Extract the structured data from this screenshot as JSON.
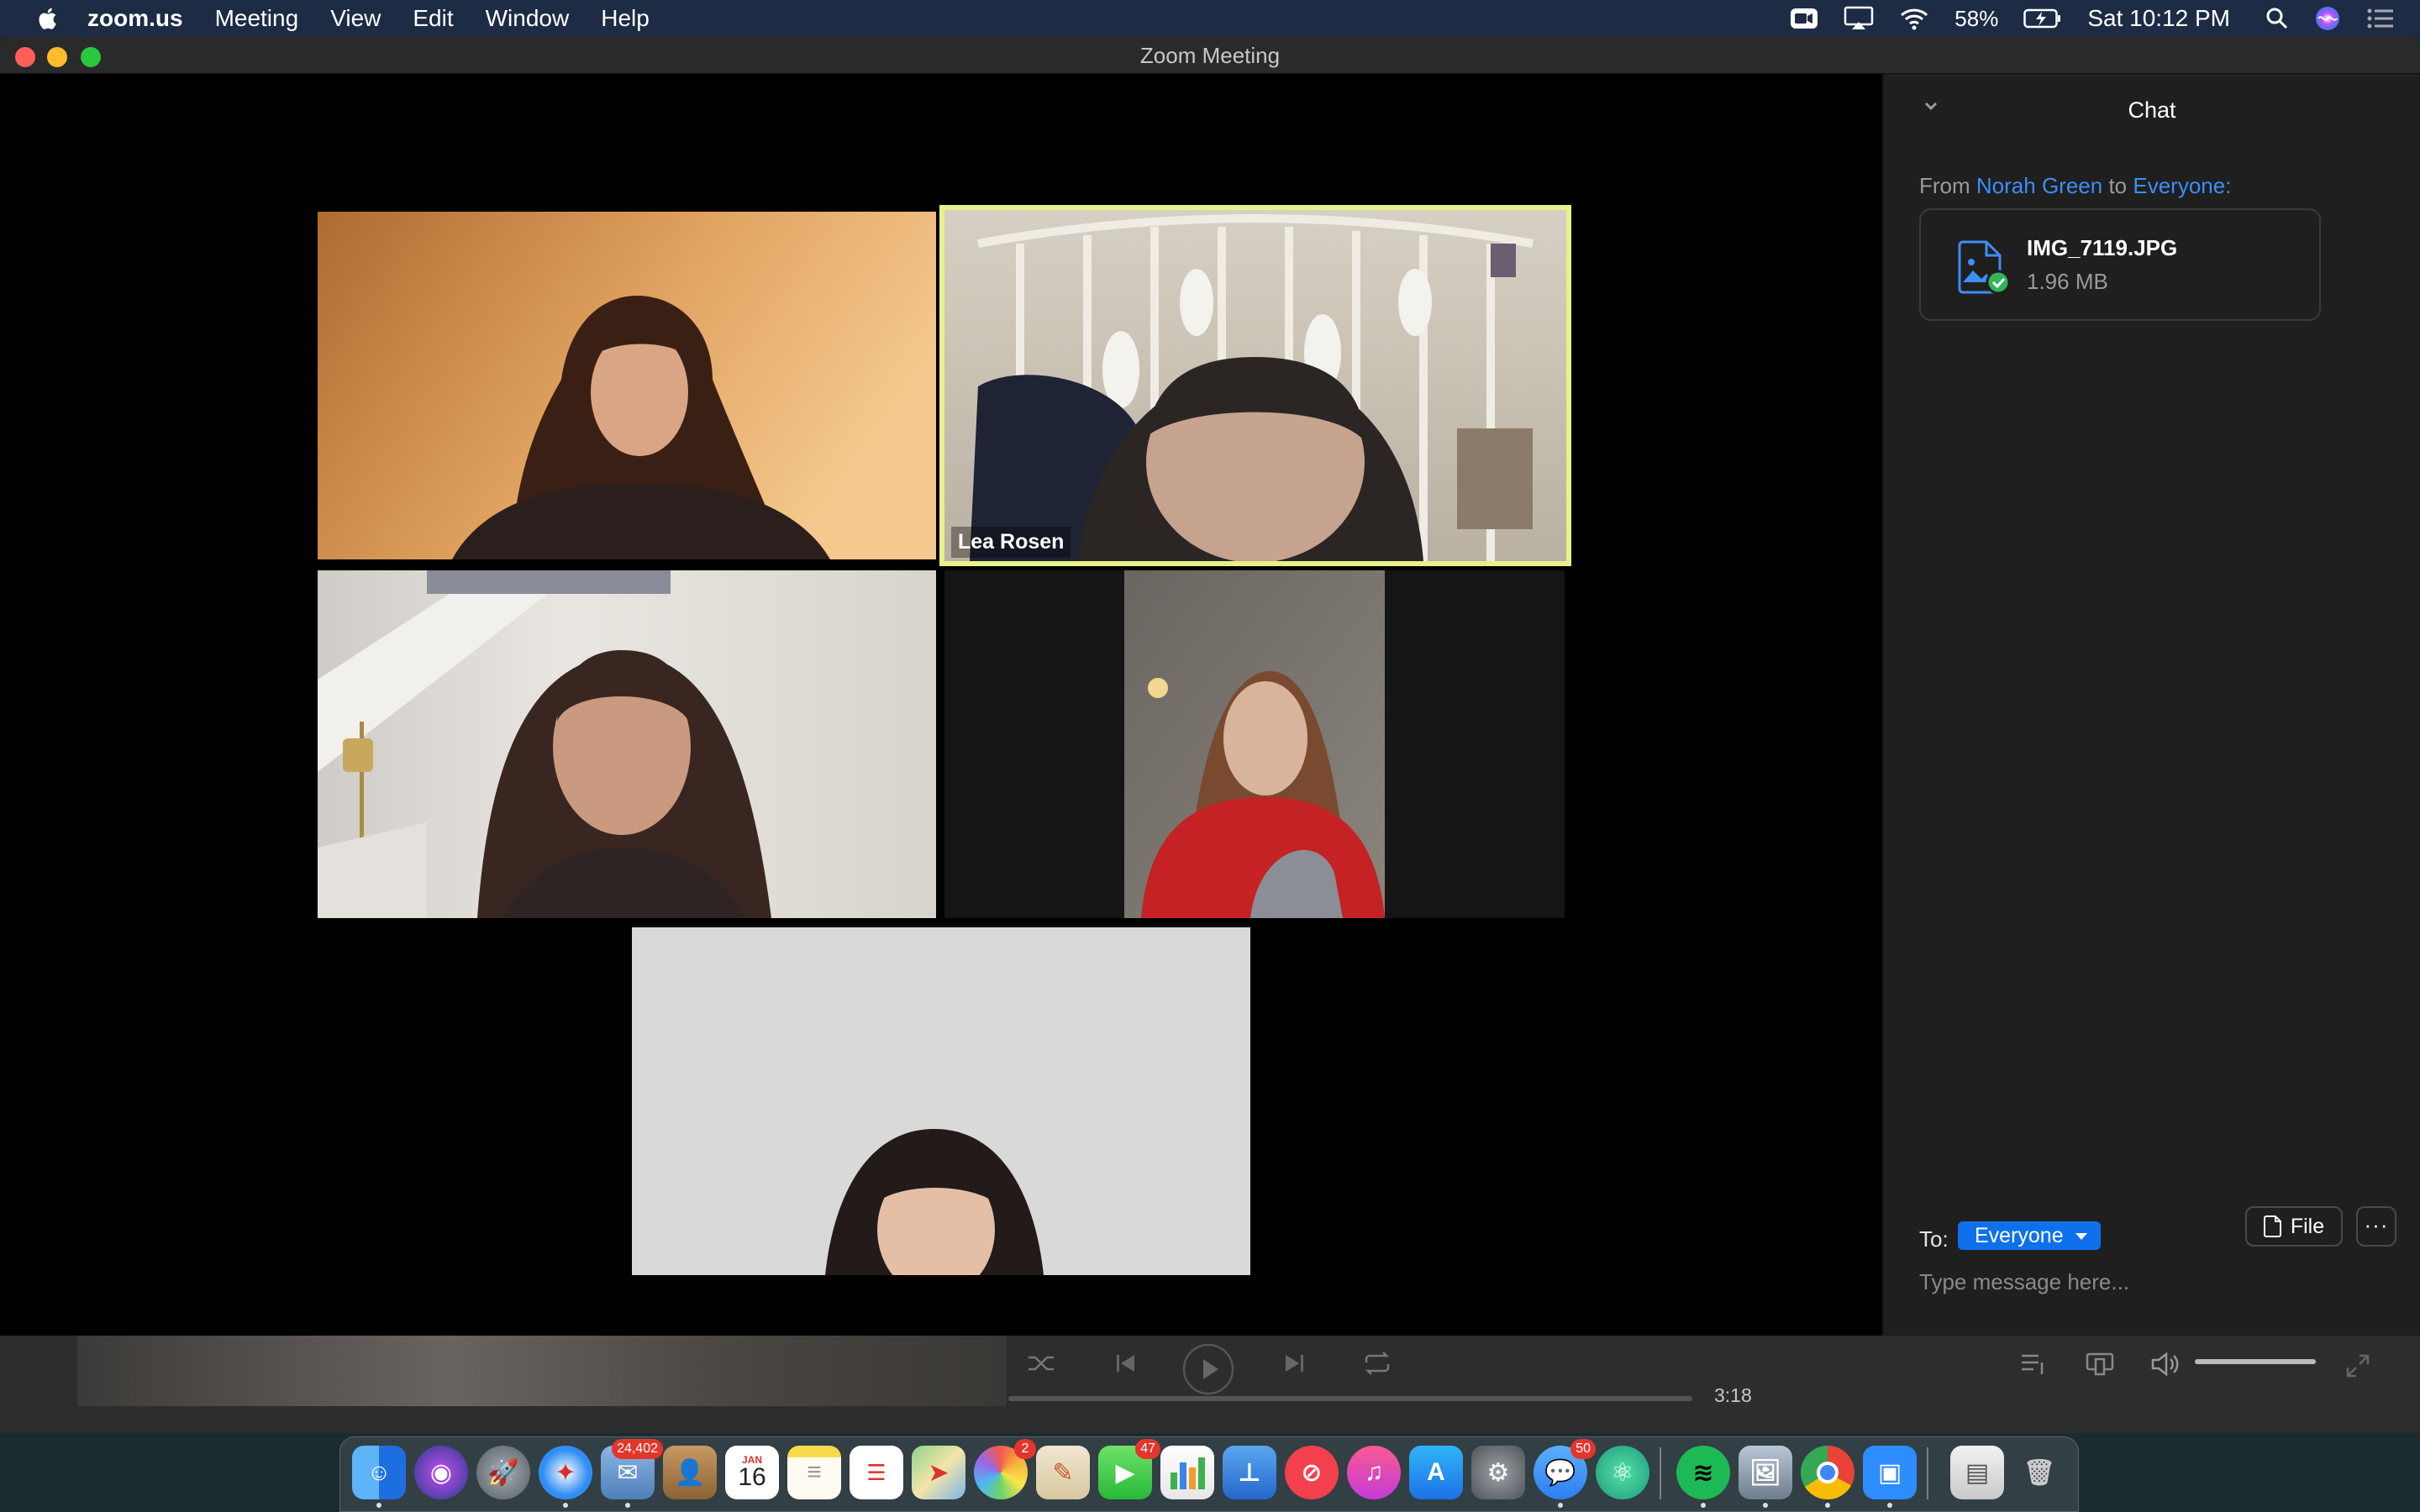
{
  "menubar": {
    "app_name": "zoom.us",
    "menus": [
      "Meeting",
      "View",
      "Edit",
      "Window",
      "Help"
    ],
    "battery": "58%",
    "clock": "Sat 10:12 PM",
    "status_icons": [
      "zoom-status-icon",
      "airplay-icon",
      "wifi-icon",
      "battery-icon",
      "spotlight-search-icon",
      "siri-icon",
      "notification-center-icon"
    ]
  },
  "window": {
    "title": "Zoom Meeting"
  },
  "video": {
    "participants": [
      {
        "label": "",
        "active_speaker": false
      },
      {
        "label": "Lea Rosen",
        "active_speaker": true
      },
      {
        "label": "",
        "active_speaker": false
      },
      {
        "label": "",
        "active_speaker": false
      },
      {
        "label": "",
        "active_speaker": false
      }
    ],
    "active_speaker_color": "#e8f08a"
  },
  "chat": {
    "title": "Chat",
    "from_prefix": "From",
    "sender": "Norah Green",
    "to_word": "to",
    "recipient": "Everyone:",
    "file": {
      "name": "IMG_7119.JPG",
      "size": "1.96 MB"
    },
    "to_label": "To:",
    "to_value": "Everyone",
    "file_button": "File",
    "more_button": "···",
    "input_placeholder": "Type message here...",
    "accent_color": "#0e71eb",
    "link_color": "#3d8ef7"
  },
  "music": {
    "elapsed": "3:18",
    "progress": 0.0
  },
  "dock": {
    "badges": {
      "mail": "24,402",
      "calendar_month": "JAN",
      "calendar_day": "16",
      "photos": "2",
      "facetime": "47",
      "messages": "50"
    }
  }
}
